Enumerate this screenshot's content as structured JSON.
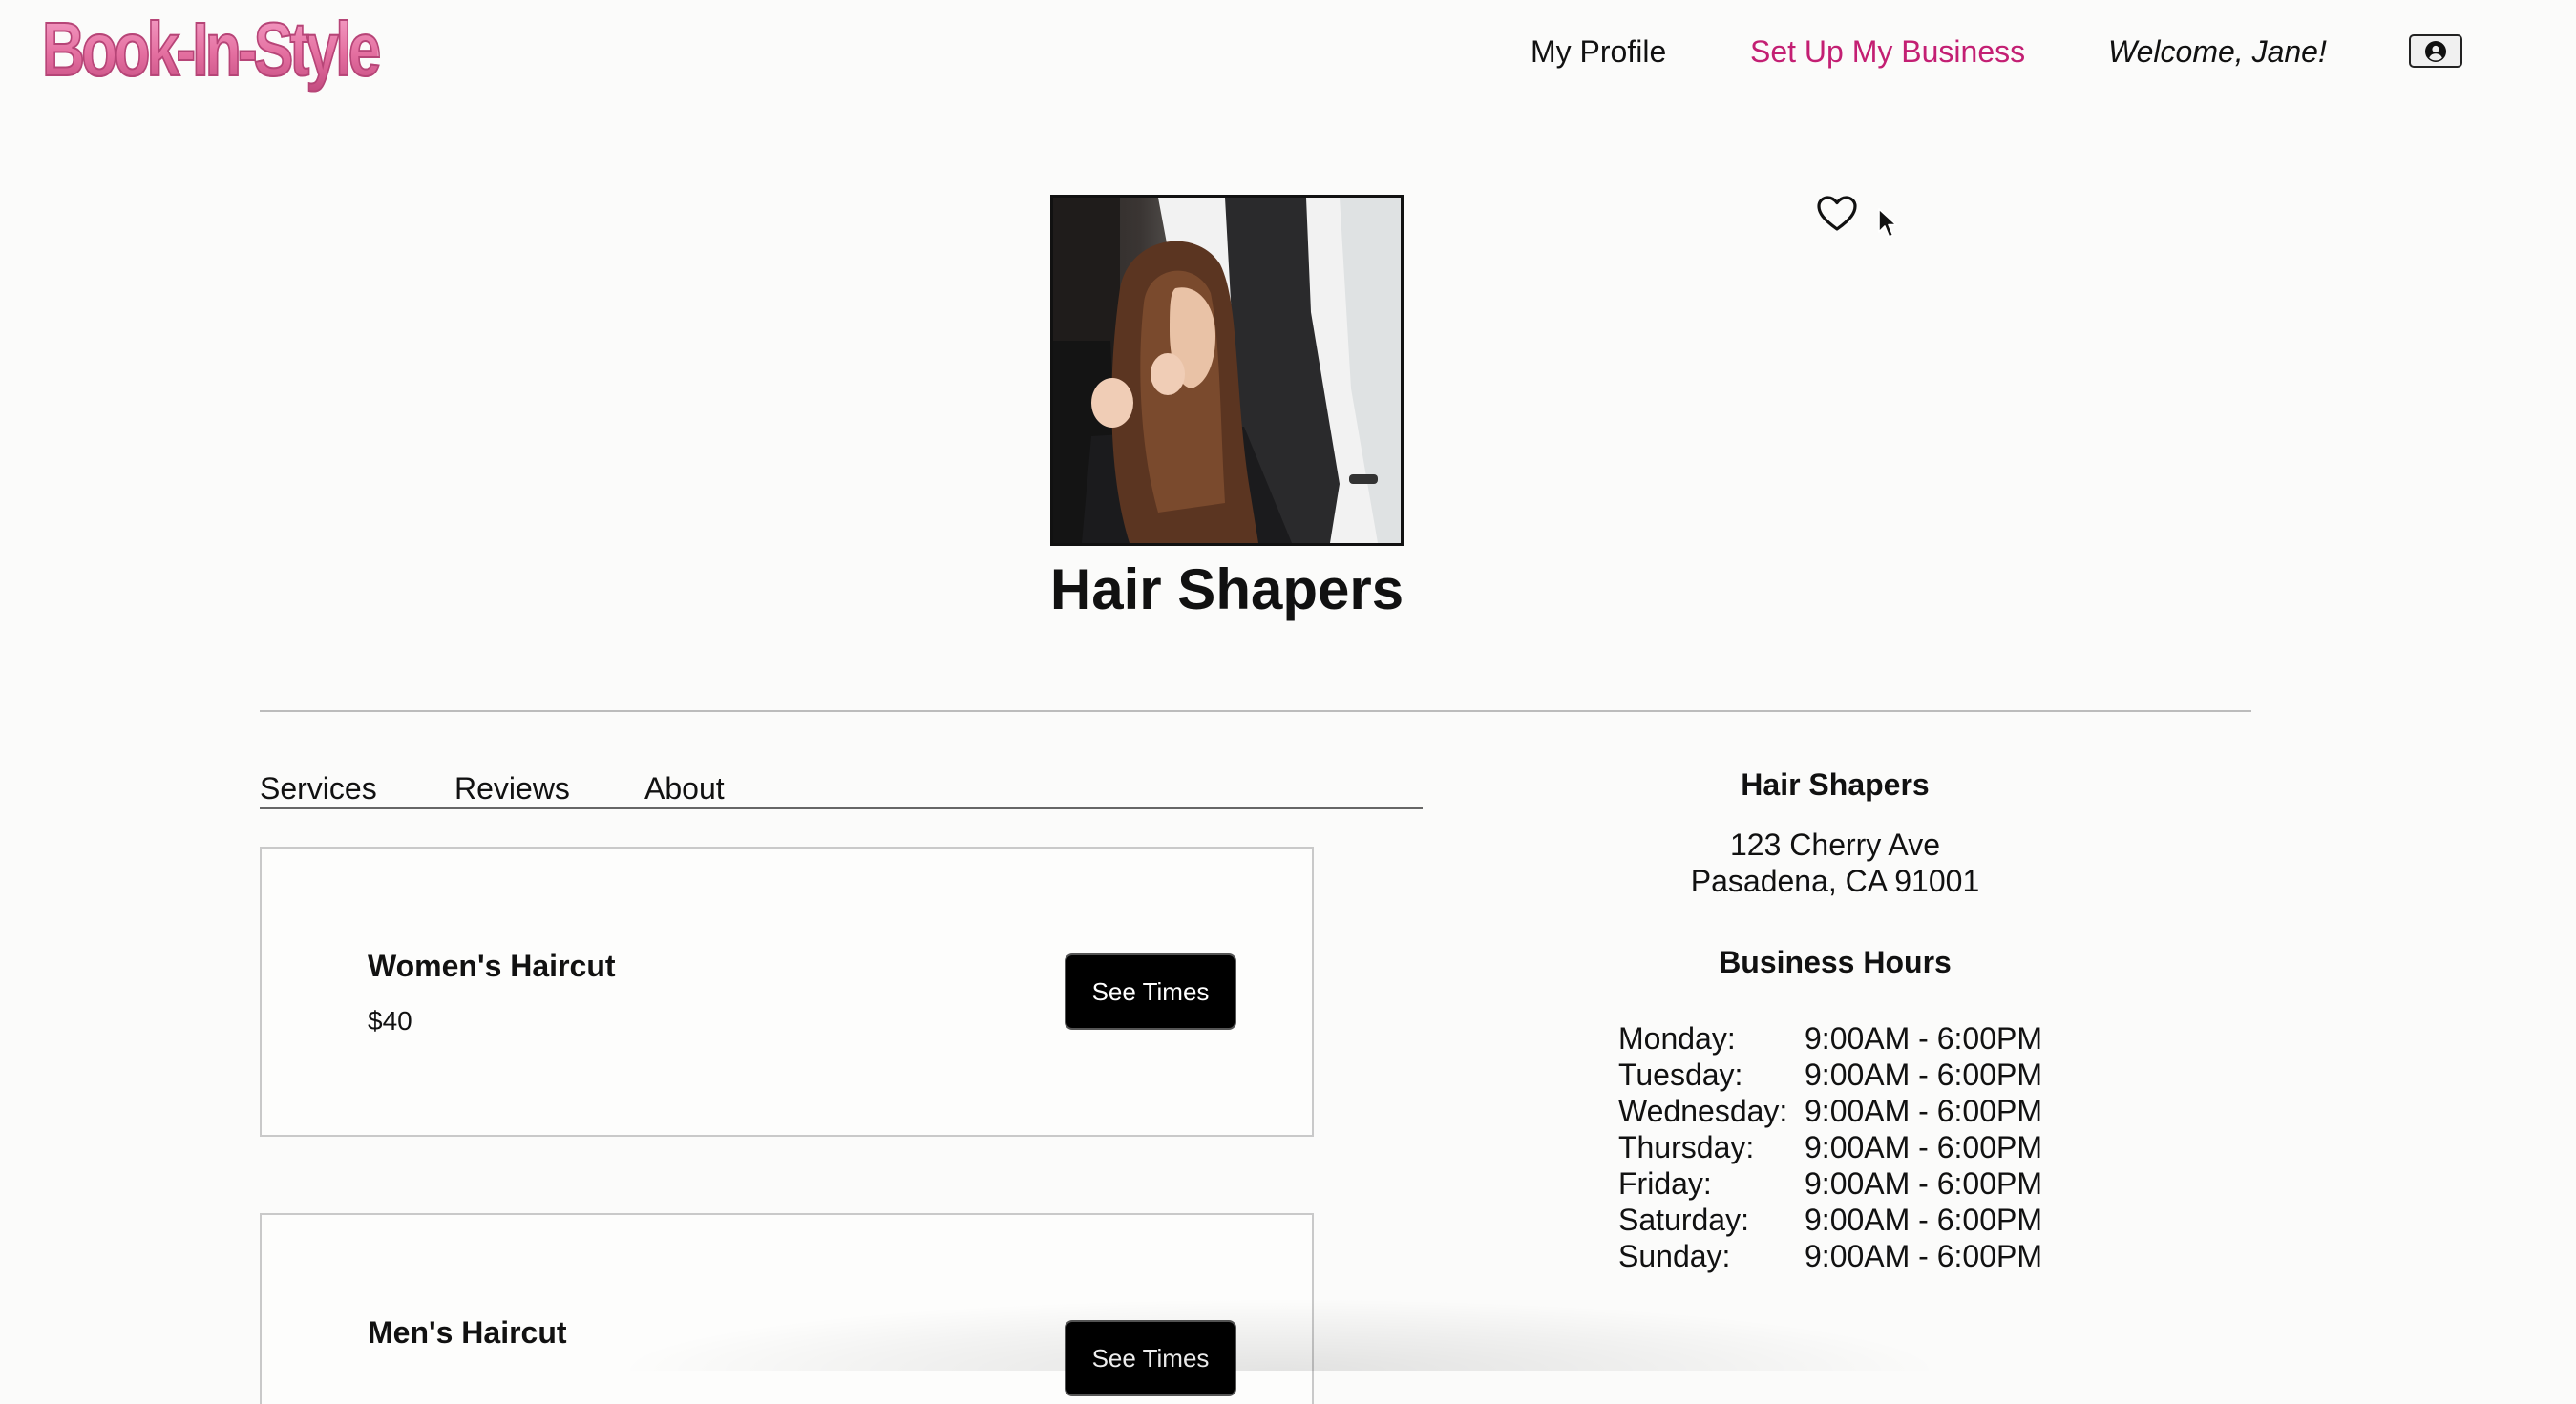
{
  "header": {
    "logo_text": "Book-In-Style",
    "nav_profile": "My Profile",
    "nav_business": "Set Up My Business",
    "welcome": "Welcome, Jane!",
    "account_icon": "user-circle-icon",
    "accent_color": "#c31f73",
    "logo_color": "#e46fa0"
  },
  "business": {
    "name": "Hair Shapers",
    "favorite_icon": "heart-outline-icon"
  },
  "tabs": [
    {
      "label": "Services"
    },
    {
      "label": "Reviews"
    },
    {
      "label": "About"
    }
  ],
  "services": [
    {
      "name": "Women's Haircut",
      "price": "$40",
      "button": "See Times"
    },
    {
      "name": "Men's Haircut",
      "button": "See Times"
    }
  ],
  "info": {
    "name": "Hair Shapers",
    "address_line1": "123 Cherry Ave",
    "address_line2": "Pasadena, CA 91001",
    "hours_title": "Business Hours",
    "hours": [
      {
        "day": "Monday:",
        "time": "9:00AM - 6:00PM"
      },
      {
        "day": "Tuesday:",
        "time": "9:00AM - 6:00PM"
      },
      {
        "day": "Wednesday:",
        "time": "9:00AM - 6:00PM"
      },
      {
        "day": "Thursday:",
        "time": "9:00AM - 6:00PM"
      },
      {
        "day": "Friday:",
        "time": "9:00AM - 6:00PM"
      },
      {
        "day": "Saturday:",
        "time": "9:00AM - 6:00PM"
      },
      {
        "day": "Sunday:",
        "time": "9:00AM - 6:00PM"
      }
    ]
  }
}
